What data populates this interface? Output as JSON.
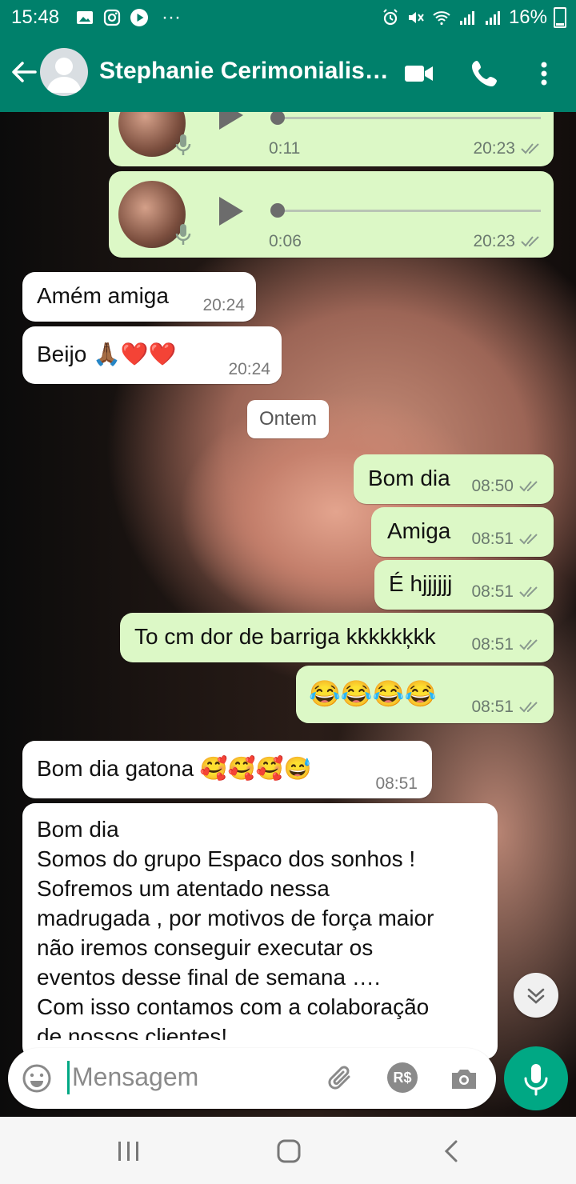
{
  "status_bar": {
    "time": "15:48",
    "battery": "16%",
    "left_icons": [
      "gallery-icon",
      "instagram-icon",
      "play-icon",
      "more-dots"
    ],
    "right_icons": [
      "alarm-icon",
      "mute-icon",
      "wifi-icon",
      "signal-icon",
      "signal-icon",
      "battery-icon"
    ]
  },
  "header": {
    "contact_name": "Stephanie Cerimonialis…",
    "icons": [
      "back-arrow-icon",
      "avatar",
      "video-call-icon",
      "phone-icon",
      "more-vert-icon"
    ]
  },
  "messages": [
    {
      "type": "voice",
      "direction": "out",
      "duration": "0:11",
      "time": "20:23",
      "status": "read"
    },
    {
      "type": "voice",
      "direction": "out",
      "duration": "0:06",
      "time": "20:23",
      "status": "read"
    },
    {
      "type": "text",
      "direction": "in",
      "text": "Amém amiga",
      "time": "20:24"
    },
    {
      "type": "text",
      "direction": "in",
      "text": "Beijo 🙏🏾❤️❤️",
      "time": "20:24"
    },
    {
      "type": "date",
      "text": "Ontem"
    },
    {
      "type": "text",
      "direction": "out",
      "text": "Bom dia",
      "time": "08:50",
      "status": "read"
    },
    {
      "type": "text",
      "direction": "out",
      "text": "Amiga",
      "time": "08:51",
      "status": "read"
    },
    {
      "type": "text",
      "direction": "out",
      "text": "É hjjjjjj",
      "time": "08:51",
      "status": "read"
    },
    {
      "type": "text",
      "direction": "out",
      "text": "To cm dor de barriga kkkkkķkk",
      "time": "08:51",
      "status": "read"
    },
    {
      "type": "text",
      "direction": "out",
      "text": "😂😂😂😂",
      "time": "08:51",
      "status": "read"
    },
    {
      "type": "text",
      "direction": "in",
      "text": "Bom dia gatona 🥰🥰🥰😅",
      "time": "08:51"
    },
    {
      "type": "text",
      "direction": "in",
      "lines": [
        "Bom dia",
        "Somos do grupo Espaco dos sonhos !",
        "Sofremos um atentado nessa",
        "madrugada , por motivos de força maior",
        "não iremos conseguir executar os",
        "eventos desse final de semana ….",
        "Com isso contamos com a colaboração",
        "de nossos clientes!"
      ]
    }
  ],
  "input": {
    "placeholder": "Mensagem",
    "currency_label": "R$"
  },
  "colors": {
    "header": "#00806b",
    "outgoing_bubble": "#dcf8c6",
    "incoming_bubble": "#ffffff",
    "accent": "#00a884",
    "read_ticks": "#8a9a8f"
  }
}
